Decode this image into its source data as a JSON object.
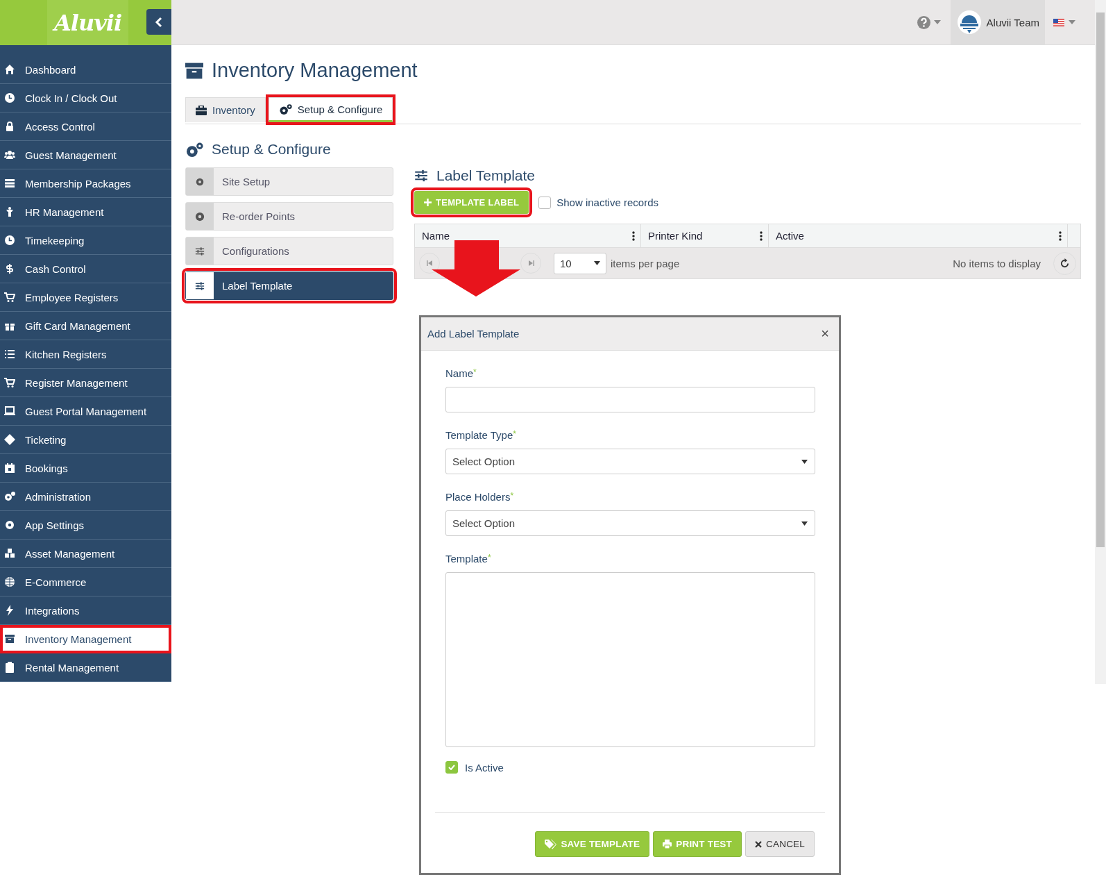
{
  "logo": {
    "text": "Aluvii"
  },
  "header": {
    "user": "Aluvii Team"
  },
  "sidebar": {
    "items": [
      {
        "label": "Dashboard",
        "selected": false,
        "highlighted": false
      },
      {
        "label": "Clock In / Clock Out",
        "selected": false,
        "highlighted": false
      },
      {
        "label": "Access Control",
        "selected": false,
        "highlighted": false
      },
      {
        "label": "Guest Management",
        "selected": false,
        "highlighted": false
      },
      {
        "label": "Membership Packages",
        "selected": false,
        "highlighted": false
      },
      {
        "label": "HR Management",
        "selected": false,
        "highlighted": false
      },
      {
        "label": "Timekeeping",
        "selected": false,
        "highlighted": false
      },
      {
        "label": "Cash Control",
        "selected": false,
        "highlighted": false
      },
      {
        "label": "Employee Registers",
        "selected": false,
        "highlighted": false
      },
      {
        "label": "Gift Card Management",
        "selected": false,
        "highlighted": false
      },
      {
        "label": "Kitchen Registers",
        "selected": false,
        "highlighted": false
      },
      {
        "label": "Register Management",
        "selected": false,
        "highlighted": false
      },
      {
        "label": "Guest Portal Management",
        "selected": false,
        "highlighted": false
      },
      {
        "label": "Ticketing",
        "selected": false,
        "highlighted": false
      },
      {
        "label": "Bookings",
        "selected": false,
        "highlighted": false
      },
      {
        "label": "Administration",
        "selected": false,
        "highlighted": false
      },
      {
        "label": "App Settings",
        "selected": false,
        "highlighted": false
      },
      {
        "label": "Asset Management",
        "selected": false,
        "highlighted": false
      },
      {
        "label": "E-Commerce",
        "selected": false,
        "highlighted": false
      },
      {
        "label": "Integrations",
        "selected": false,
        "highlighted": false
      },
      {
        "label": "Inventory Management",
        "selected": true,
        "highlighted": true
      },
      {
        "label": "Rental Management",
        "selected": false,
        "highlighted": false
      }
    ]
  },
  "page": {
    "title": "Inventory Management"
  },
  "tabs": [
    {
      "label": "Inventory",
      "selected": false,
      "highlighted": false
    },
    {
      "label": "Setup & Configure",
      "selected": true,
      "highlighted": true
    }
  ],
  "section": {
    "title": "Setup & Configure"
  },
  "subnav": [
    {
      "label": "Site Setup",
      "selected": false,
      "highlighted": false
    },
    {
      "label": "Re-order Points",
      "selected": false,
      "highlighted": false
    },
    {
      "label": "Configurations",
      "selected": false,
      "highlighted": false
    },
    {
      "label": "Label Template",
      "selected": true,
      "highlighted": true
    }
  ],
  "panel": {
    "title": "Label Template",
    "add_button": {
      "label": "TEMPLATE LABEL",
      "highlighted": true
    },
    "show_inactive": {
      "label": "Show inactive records",
      "checked": false
    }
  },
  "table": {
    "columns": [
      "Name",
      "Printer Kind",
      "Active"
    ],
    "pager": {
      "page_size": "10",
      "page_size_label": "items per page",
      "status": "No items to display"
    }
  },
  "dialog": {
    "title": "Add Label Template",
    "close": "×",
    "fields": [
      {
        "kind": "text",
        "label": "Name",
        "required_mark": "*"
      },
      {
        "kind": "select",
        "label": "Template Type",
        "required_mark": "*",
        "value": "Select Option"
      },
      {
        "kind": "select",
        "label": "Place Holders",
        "required_mark": "*",
        "value": "Select Option"
      },
      {
        "kind": "textarea",
        "label": "Template",
        "required_mark": "*"
      }
    ],
    "is_active": {
      "label": "Is Active",
      "checked": true
    },
    "buttons": [
      {
        "kind": "save",
        "label": "SAVE TEMPLATE"
      },
      {
        "kind": "print",
        "label": "PRINT TEST"
      },
      {
        "kind": "cancel",
        "label": "CANCEL"
      }
    ]
  }
}
